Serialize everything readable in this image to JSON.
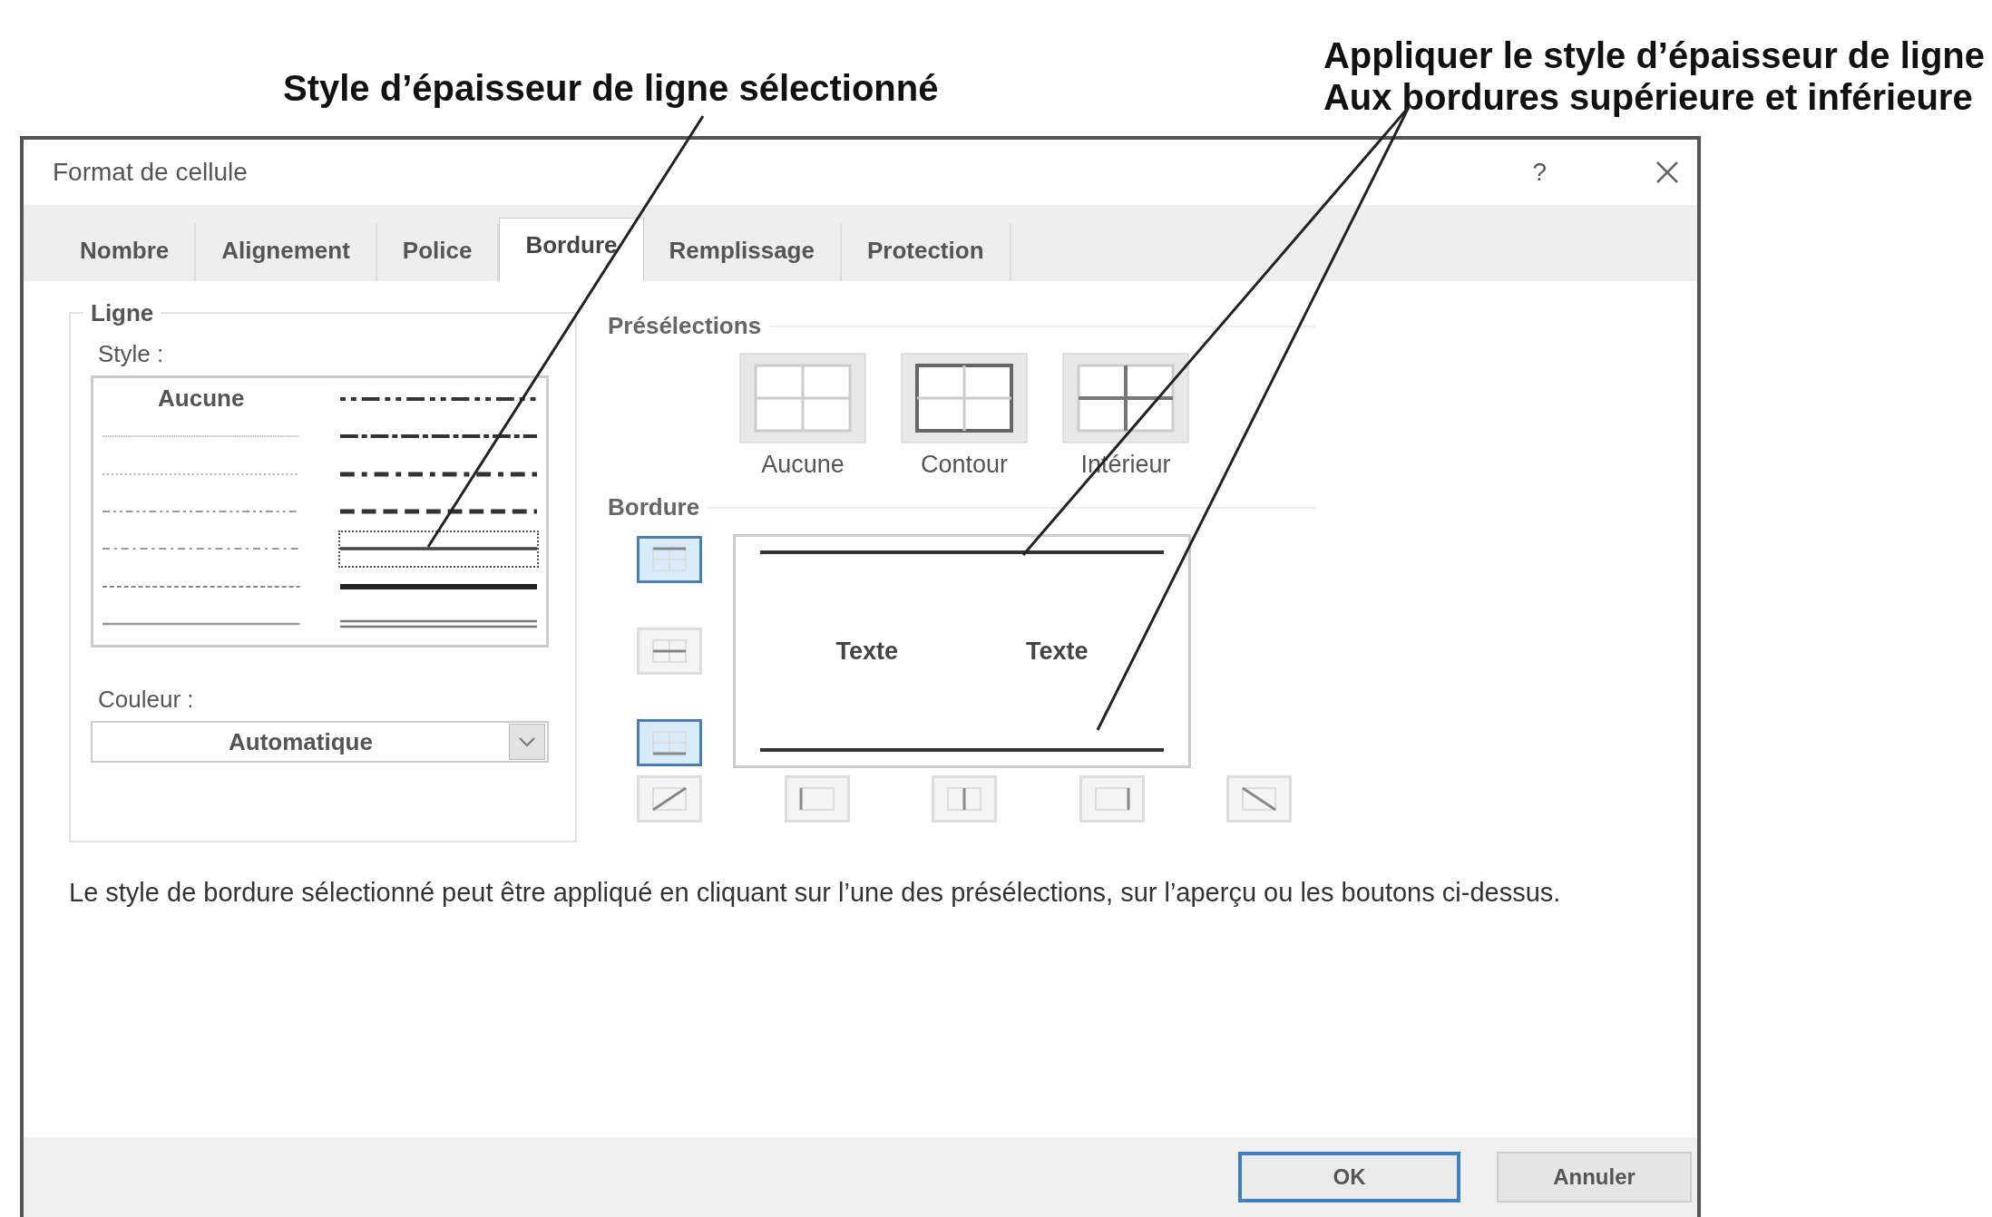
{
  "annotations": [
    {
      "lines": [
        "Style d’épaisseur de ligne sélectionné"
      ]
    },
    {
      "lines": [
        "Appliquer le style d’épaisseur de ligne",
        "Aux bordures supérieure et inférieure"
      ]
    }
  ],
  "window": {
    "title": "Format de cellule",
    "help": "?"
  },
  "tabs": [
    {
      "label": "Nombre",
      "selected": false
    },
    {
      "label": "Alignement",
      "selected": false
    },
    {
      "label": "Police",
      "selected": false
    },
    {
      "label": "Bordure",
      "selected": true
    },
    {
      "label": "Remplissage",
      "selected": false
    },
    {
      "label": "Protection",
      "selected": false
    }
  ],
  "line_group": {
    "legend": "Ligne",
    "style_label": "Style :",
    "styles": [
      {
        "kind": "none",
        "label": "Aucune",
        "selected": false
      },
      {
        "kind": "hair",
        "selected": false
      },
      {
        "kind": "dotted",
        "selected": false
      },
      {
        "kind": "dash-dot-dot",
        "selected": false
      },
      {
        "kind": "dash-dot",
        "selected": false
      },
      {
        "kind": "dashed",
        "selected": false
      },
      {
        "kind": "thin",
        "selected": false
      },
      {
        "kind": "medium-dash-dot-dot",
        "selected": false
      },
      {
        "kind": "slanted-dash-dot",
        "selected": false
      },
      {
        "kind": "medium-dash-dot",
        "selected": false
      },
      {
        "kind": "medium-dashed",
        "selected": false
      },
      {
        "kind": "medium",
        "selected": true
      },
      {
        "kind": "thick",
        "selected": false
      },
      {
        "kind": "double",
        "selected": false
      }
    ],
    "color_label": "Couleur :",
    "color_value": "Automatique"
  },
  "presets_label": "Présélections",
  "presets": [
    {
      "kind": "none",
      "label": "Aucune"
    },
    {
      "kind": "outline",
      "label": "Contour"
    },
    {
      "kind": "inside",
      "label": "Intérieur"
    }
  ],
  "border_label": "Bordure",
  "border_buttons": [
    {
      "kind": "top",
      "on": true
    },
    {
      "kind": "middle",
      "on": false
    },
    {
      "kind": "bottom",
      "on": true
    },
    {
      "kind": "diagonal-up",
      "on": false
    },
    {
      "kind": "left",
      "on": false
    },
    {
      "kind": "center",
      "on": false
    },
    {
      "kind": "right",
      "on": false
    },
    {
      "kind": "diagonal-down",
      "on": false
    }
  ],
  "preview_texts": [
    "Texte",
    "Texte"
  ],
  "description": "Le style de bordure sélectionné peut être appliqué en cliquant sur l’une des présélections, sur l’aperçu ou les boutons ci-dessus.",
  "buttons": [
    {
      "label": "OK",
      "default": true
    },
    {
      "label": "Annuler",
      "default": false
    }
  ]
}
